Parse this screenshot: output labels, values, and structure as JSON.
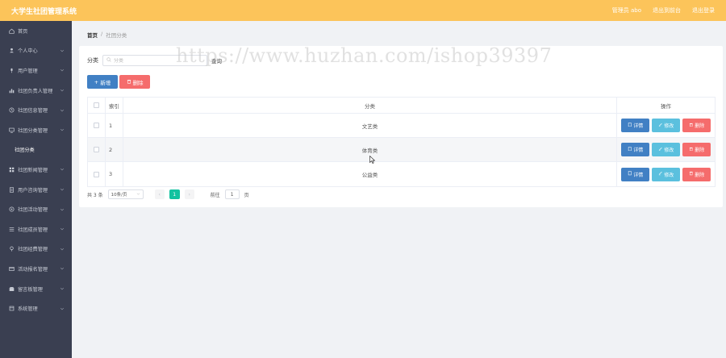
{
  "header": {
    "title": "大学生社团管理系统",
    "admin_label": "管理员 abo",
    "link_front": "退出到前台",
    "link_logout": "退出登录"
  },
  "sidebar": {
    "items": [
      {
        "label": "首页",
        "icon": "home-icon",
        "has_chevron": false
      },
      {
        "label": "个人中心",
        "icon": "user-icon",
        "has_chevron": true
      },
      {
        "label": "用户管理",
        "icon": "mic-icon",
        "has_chevron": true
      },
      {
        "label": "社团负责人管理",
        "icon": "bar-chart-icon",
        "has_chevron": true
      },
      {
        "label": "社团信息管理",
        "icon": "clock-icon",
        "has_chevron": true
      },
      {
        "label": "社团分类管理",
        "icon": "monitor-icon",
        "has_chevron": true
      },
      {
        "label": "社团分类",
        "icon": "",
        "has_chevron": false,
        "sub": true
      },
      {
        "label": "社团新闻管理",
        "icon": "grid-icon",
        "has_chevron": true
      },
      {
        "label": "用户咨询管理",
        "icon": "doc-icon",
        "has_chevron": true
      },
      {
        "label": "社团活动管理",
        "icon": "circle-icon",
        "has_chevron": true
      },
      {
        "label": "社团成员管理",
        "icon": "list-icon",
        "has_chevron": true
      },
      {
        "label": "社团经费管理",
        "icon": "pin-icon",
        "has_chevron": true
      },
      {
        "label": "活动报名管理",
        "icon": "card-icon",
        "has_chevron": true
      },
      {
        "label": "留言板管理",
        "icon": "box-icon",
        "has_chevron": true
      },
      {
        "label": "系统管理",
        "icon": "frame-icon",
        "has_chevron": true
      }
    ]
  },
  "breadcrumb": {
    "home": "首页",
    "separator": "/",
    "current": "社团分类"
  },
  "filter": {
    "label": "分类",
    "placeholder": "分类",
    "search_label": "查询"
  },
  "actions": {
    "add_label": "新增",
    "delete_label": "删除"
  },
  "table": {
    "headers": {
      "index": "索引",
      "category": "分类",
      "ops": "操作"
    },
    "rows": [
      {
        "index": "1",
        "category": "文艺类"
      },
      {
        "index": "2",
        "category": "体育类"
      },
      {
        "index": "3",
        "category": "公益类"
      }
    ],
    "op_detail": "详情",
    "op_edit": "修改",
    "op_delete": "删除"
  },
  "pager": {
    "total": "共 3 条",
    "page_size": "10条/页",
    "current_page": "1",
    "goto_label": "前往",
    "goto_value": "1",
    "page_unit": "页"
  },
  "watermark": "https://www.huzhan.com/ishop39397",
  "colors": {
    "header": "#fcc45a",
    "sidebar": "#3a3f51",
    "primary": "#4180c4",
    "info": "#5bc0de",
    "danger": "#f56c6c",
    "page_active": "#13c2a0"
  }
}
